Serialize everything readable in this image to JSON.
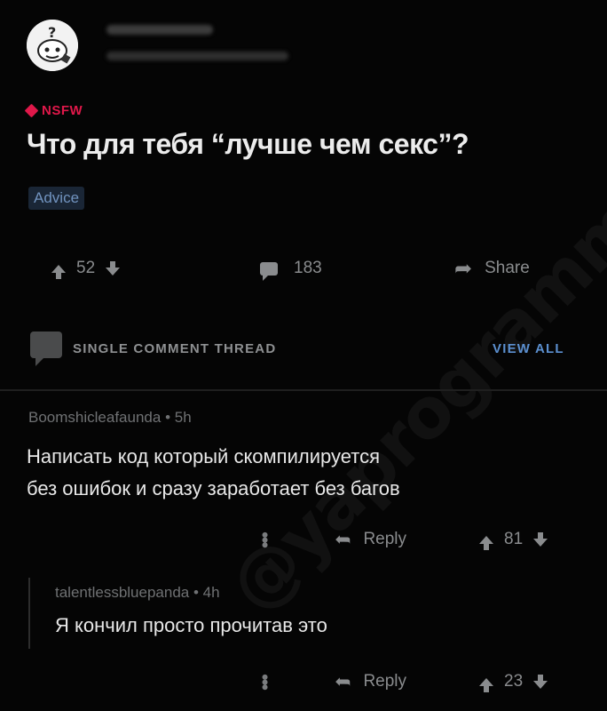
{
  "post": {
    "nsfw_label": "NSFW",
    "title": "Что для тебя “лучше чем секс”?",
    "flair": "Advice",
    "votes": "52",
    "comments": "183",
    "share_label": "Share"
  },
  "thread": {
    "label": "SINGLE COMMENT THREAD",
    "view_all": "VIEW ALL"
  },
  "comments": [
    {
      "author": "Boomshicleafaunda",
      "age": "5h",
      "lines": [
        "Написать код который скомпилируется",
        "без ошибок и сразу заработает без багов"
      ],
      "reply_label": "Reply",
      "votes": "81"
    },
    {
      "author": "talentlessbluepanda",
      "age": "4h",
      "lines": [
        "Я кончил просто прочитав это"
      ],
      "reply_label": "Reply",
      "votes": "23"
    }
  ],
  "watermark": "@yaprogrammer",
  "colors": {
    "background": "#050505",
    "nsfw": "#e0184a",
    "link": "#5b8fcf",
    "flair_bg": "#1a2636"
  }
}
